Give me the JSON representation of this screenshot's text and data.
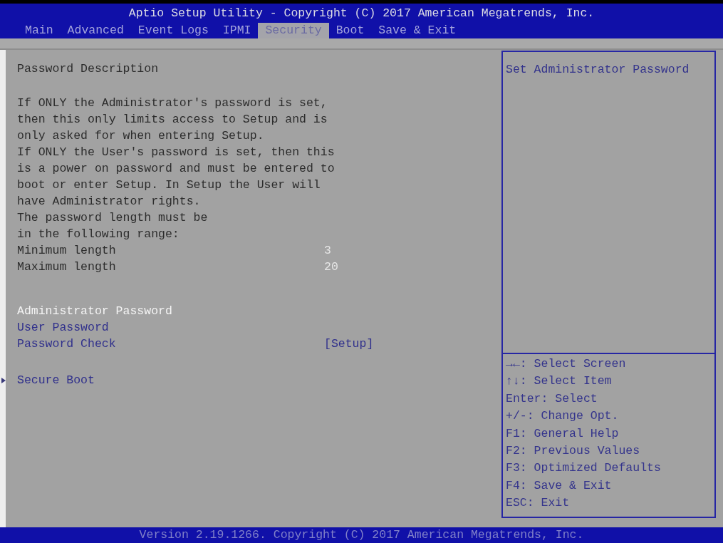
{
  "window": {
    "title": "Aptio Setup Utility - Copyright (C) 2017 American Megatrends, Inc."
  },
  "tabs": [
    {
      "label": "Main",
      "selected": false
    },
    {
      "label": "Advanced",
      "selected": false
    },
    {
      "label": "Event Logs",
      "selected": false
    },
    {
      "label": "IPMI",
      "selected": false
    },
    {
      "label": "Security",
      "selected": true
    },
    {
      "label": "Boot",
      "selected": false
    },
    {
      "label": "Save & Exit",
      "selected": false
    }
  ],
  "description": {
    "heading": "Password Description",
    "paragraphs": [
      [
        "If ONLY the Administrator's password is set,",
        "then this only limits access to Setup and is",
        "only asked for when entering Setup."
      ],
      [
        "If ONLY the User's password is set, then this",
        "is a power on password and must be entered to",
        "boot or enter Setup. In Setup the User will",
        "have Administrator rights."
      ],
      [
        "The password length must be",
        "in the following range:"
      ]
    ]
  },
  "length_limits": [
    {
      "label": "Minimum length",
      "value": "3"
    },
    {
      "label": "Maximum length",
      "value": "20"
    }
  ],
  "menu_items": [
    {
      "kind": "action",
      "label": "Administrator Password",
      "selected": true
    },
    {
      "kind": "action",
      "label": "User Password",
      "selected": false
    },
    {
      "kind": "option",
      "label": "Password Check",
      "value": "[Setup]",
      "selected": false
    },
    {
      "kind": "submenu",
      "label": "Secure Boot",
      "selected": false
    }
  ],
  "help_panel": {
    "item_help": "Set Administrator Password",
    "key_hints": [
      "→←: Select Screen",
      "↑↓: Select Item",
      "Enter: Select",
      "+/-: Change Opt.",
      "F1: General Help",
      "F2: Previous Values",
      "F3: Optimized Defaults",
      "F4: Save & Exit",
      "ESC: Exit"
    ]
  },
  "status_bar": "Version 2.19.1266. Copyright (C) 2017 American Megatrends, Inc."
}
